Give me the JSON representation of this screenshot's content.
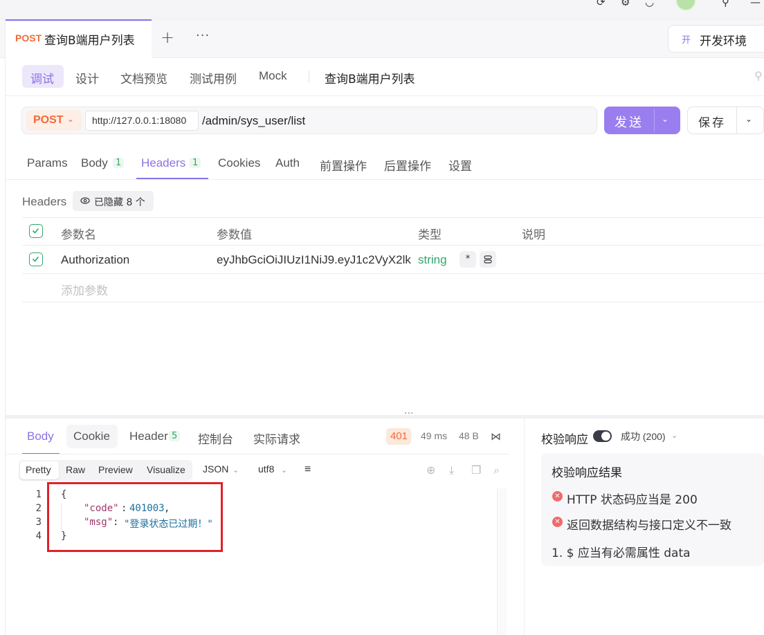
{
  "tab": {
    "method": "POST",
    "title": "查询B端用户列表",
    "new": "+",
    "more": "···"
  },
  "env": {
    "badge": "开",
    "label": "开发环境"
  },
  "subnav": {
    "items": [
      "调试",
      "设计",
      "文档预览",
      "测试用例",
      "Mock"
    ],
    "api_name": "查询B端用户列表"
  },
  "url": {
    "method": "POST",
    "base": "http://127.0.0.1:18080",
    "path": "/admin/sys_user/list"
  },
  "actions": {
    "send": "发送",
    "save": "保存"
  },
  "request_tabs": [
    {
      "label": "Params"
    },
    {
      "label": "Body",
      "badge": "1"
    },
    {
      "label": "Headers",
      "badge": "1"
    },
    {
      "label": "Cookies"
    },
    {
      "label": "Auth"
    },
    {
      "label": "前置操作"
    },
    {
      "label": "后置操作"
    },
    {
      "label": "设置"
    }
  ],
  "headers": {
    "label": "Headers",
    "hidden": "已隐藏 8 个",
    "columns": [
      "参数名",
      "参数值",
      "类型",
      "说明"
    ],
    "rows": [
      {
        "key": "Authorization",
        "value": "eyJhbGciOiJIUzI1NiJ9.eyJ1c2VyX2lk",
        "type": "string",
        "required": "*"
      }
    ],
    "add_placeholder": "添加参数"
  },
  "response": {
    "tabs": [
      {
        "label": "Body"
      },
      {
        "label": "Cookie"
      },
      {
        "label": "Header",
        "badge": "5"
      },
      {
        "label": "控制台"
      },
      {
        "label": "实际请求"
      }
    ],
    "status": "401",
    "time": "49 ms",
    "size": "48 B",
    "views": [
      "Pretty",
      "Raw",
      "Preview",
      "Visualize"
    ],
    "format": "JSON",
    "encoding": "utf8",
    "code_lines": [
      "1",
      "2",
      "3",
      "4"
    ],
    "code": {
      "open": "{",
      "key_code": "\"code\"",
      "val_code": "401003",
      "key_msg": "\"msg\"",
      "val_msg": "\"登录状态已过期！\"",
      "close": "}"
    }
  },
  "validation": {
    "label": "校验响应",
    "status": "成功 (200)",
    "title": "校验响应结果",
    "errors": [
      "HTTP 状态码应当是 200",
      "返回数据结构与接口定义不一致"
    ],
    "detail": "1. $ 应当有必需属性 data"
  },
  "colors": {
    "accent": "#8c72e6",
    "post": "#f26a3a",
    "success": "#2fa86a",
    "error": "#ef6a6a",
    "highlight_box": "#e0202a"
  }
}
